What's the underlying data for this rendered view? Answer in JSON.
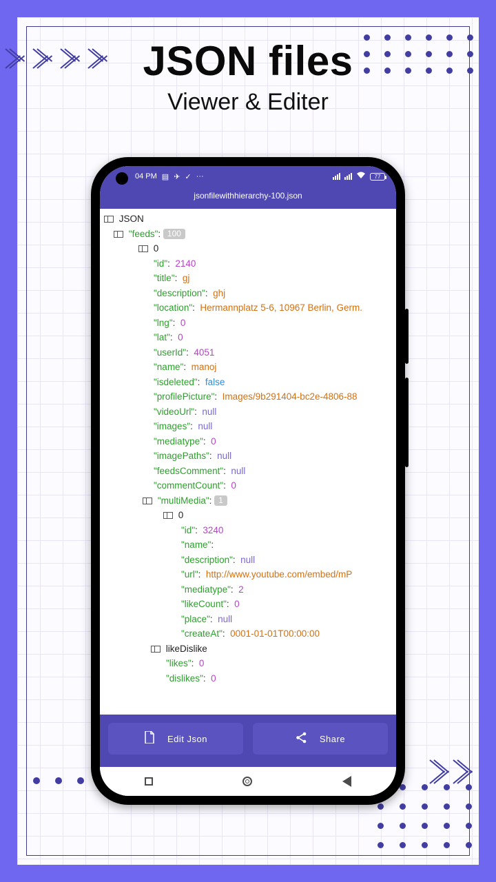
{
  "header": {
    "title": "JSON files",
    "subtitle": "Viewer & Editer"
  },
  "statusbar": {
    "time": "04 PM",
    "battery_label": "77"
  },
  "appbar": {
    "filename": "jsonfilewithhierarchy-100.json"
  },
  "tree": {
    "root_label": "JSON",
    "feeds_key": "feeds",
    "feeds_count": "100",
    "item0": {
      "index": "0",
      "id": {
        "k": "id",
        "v": "2140"
      },
      "title": {
        "k": "title",
        "v": "gj"
      },
      "description": {
        "k": "description",
        "v": "ghj"
      },
      "location": {
        "k": "location",
        "v": "Hermannplatz 5-6, 10967 Berlin, Germ."
      },
      "lng": {
        "k": "lng",
        "v": "0"
      },
      "lat": {
        "k": "lat",
        "v": "0"
      },
      "userId": {
        "k": "userId",
        "v": "4051"
      },
      "name": {
        "k": "name",
        "v": "manoj"
      },
      "isdeleted": {
        "k": "isdeleted",
        "v": "false"
      },
      "profilePicture": {
        "k": "profilePicture",
        "v": "Images/9b291404-bc2e-4806-88"
      },
      "videoUrl": {
        "k": "videoUrl",
        "v": "null"
      },
      "images": {
        "k": "images",
        "v": "null"
      },
      "mediatype": {
        "k": "mediatype",
        "v": "0"
      },
      "imagePaths": {
        "k": "imagePaths",
        "v": "null"
      },
      "feedsComment": {
        "k": "feedsComment",
        "v": "null"
      },
      "commentCount": {
        "k": "commentCount",
        "v": "0"
      },
      "multiMedia": {
        "k": "multiMedia",
        "count": "1",
        "index": "0",
        "mm_id": {
          "k": "id",
          "v": "3240"
        },
        "mm_name": {
          "k": "name",
          "v": ""
        },
        "mm_description": {
          "k": "description",
          "v": "null"
        },
        "mm_url": {
          "k": "url",
          "v": "http://www.youtube.com/embed/mP"
        },
        "mm_mediatype": {
          "k": "mediatype",
          "v": "2"
        },
        "mm_likeCount": {
          "k": "likeCount",
          "v": "0"
        },
        "mm_place": {
          "k": "place",
          "v": "null"
        },
        "mm_createAt": {
          "k": "createAt",
          "v": "0001-01-01T00:00:00"
        }
      },
      "likeDislike": {
        "label": "likeDislike",
        "likes": {
          "k": "likes",
          "v": "0"
        },
        "dislikes": {
          "k": "dislikes",
          "v": "0"
        }
      }
    }
  },
  "buttons": {
    "edit": "Edit Json",
    "share": "Share"
  }
}
